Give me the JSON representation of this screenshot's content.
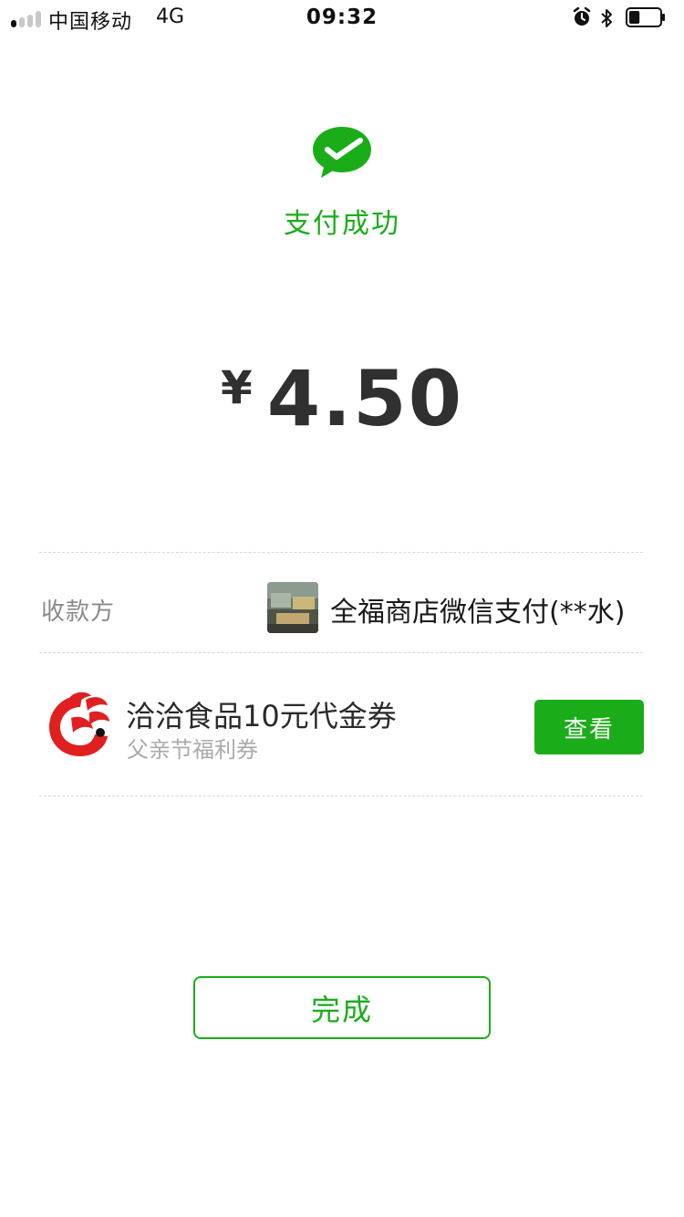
{
  "status_bar": {
    "carrier": "中国移动",
    "network": "4G",
    "time": "09:32",
    "signal_bars_active": 1,
    "signal_bars_total": 4,
    "battery_level": 0.35,
    "icons": [
      "alarm-icon",
      "bluetooth-icon",
      "battery-icon"
    ]
  },
  "result": {
    "status_text": "支付成功",
    "icon": "wechat-pay-success-icon",
    "accent_color": "#1aad19"
  },
  "payment": {
    "currency_symbol": "¥",
    "amount": "4.50"
  },
  "payee": {
    "label": "收款方",
    "merchant_name": "全福商店微信支付(**水)"
  },
  "coupon": {
    "title": "洽洽食品10元代金券",
    "subtitle": "父亲节福利券",
    "action_label": "查看",
    "logo": "qiaqia-logo"
  },
  "footer": {
    "done_label": "完成"
  }
}
